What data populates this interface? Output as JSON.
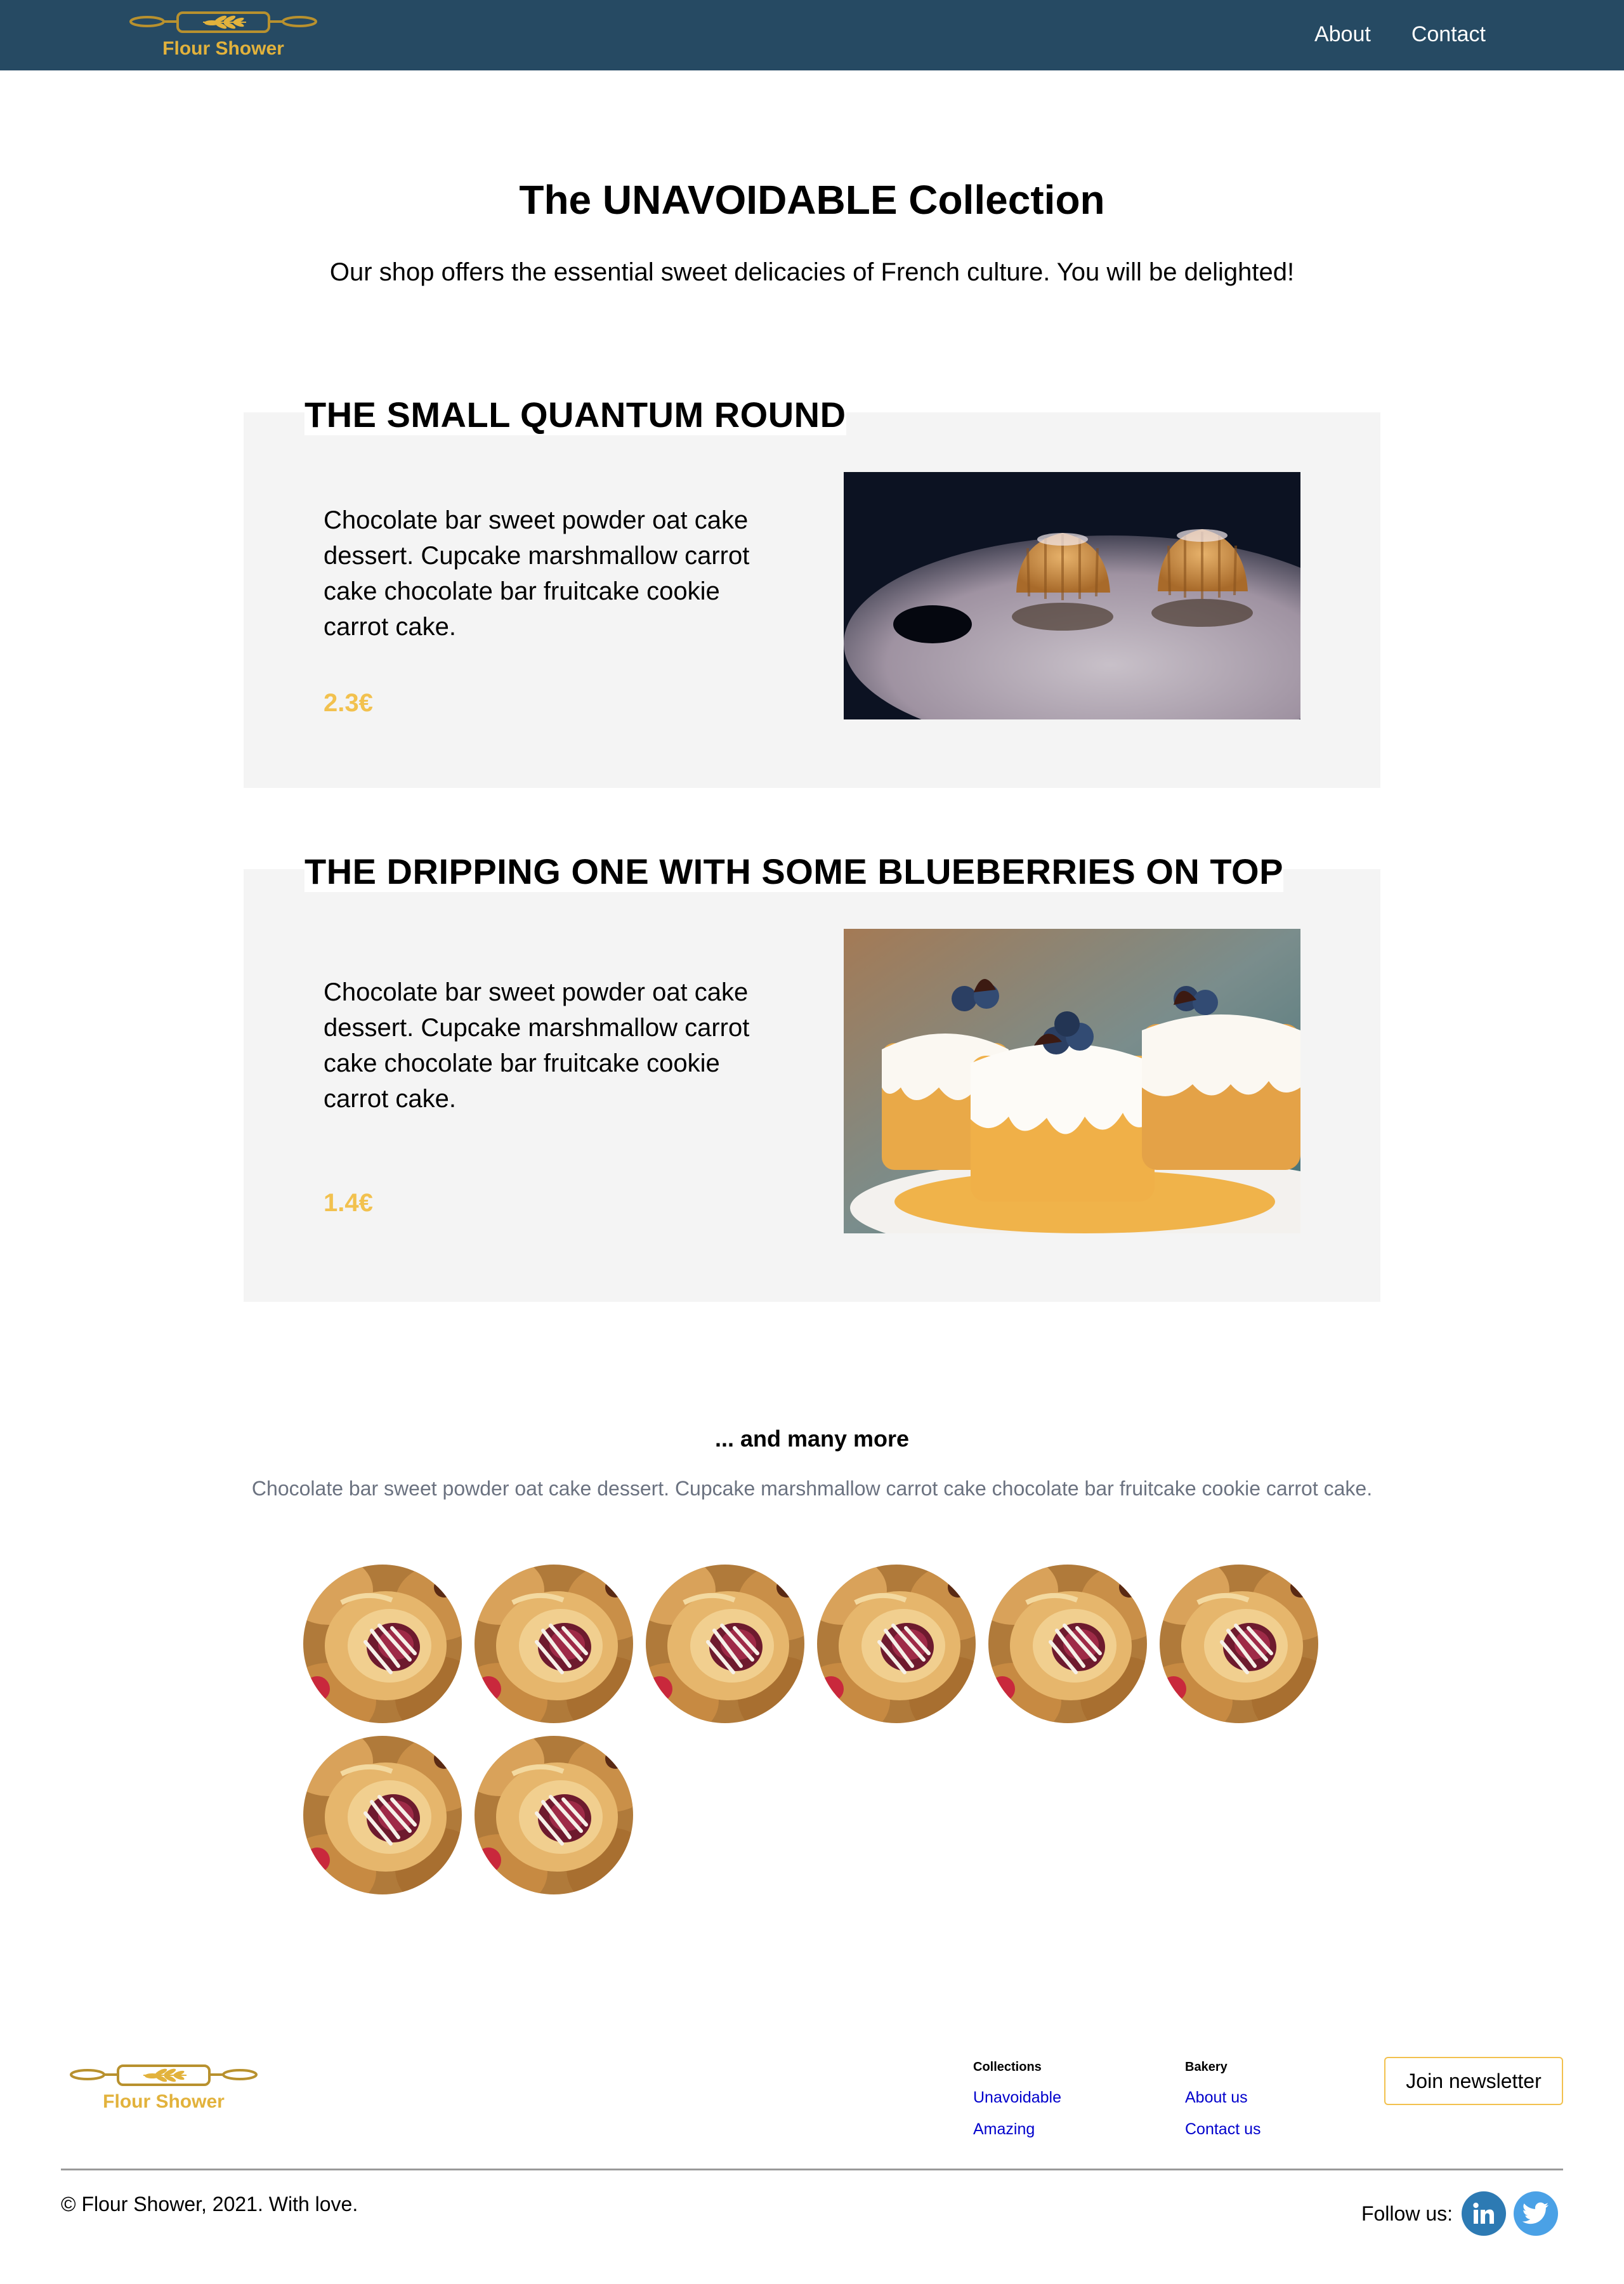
{
  "brand": {
    "name": "Flour Shower",
    "accent_color": "#f2c14e",
    "header_color": "#264a63"
  },
  "nav": {
    "items": [
      "About",
      "Contact"
    ]
  },
  "hero": {
    "title": "The UNAVOIDABLE Collection",
    "subtitle": "Our shop offers the essential sweet delicacies of French culture. You will be delighted!"
  },
  "products": [
    {
      "title": "THE SMALL QUANTUM ROUND",
      "description": "Chocolate bar sweet powder oat cake dessert. Cupcake marshmallow carrot cake chocolate bar fruitcake cookie carrot cake.",
      "price": "2.3€",
      "image": "two-mini-bundt-cakes-photo"
    },
    {
      "title": "THE DRIPPING ONE WITH SOME BLUEBERRIES ON TOP",
      "description": "Chocolate bar sweet powder oat cake dessert. Cupcake marshmallow carrot cake chocolate bar fruitcake cookie carrot cake.",
      "price": "1.4€",
      "image": "blueberry-drip-cakes-photo"
    }
  ],
  "more": {
    "title": "... and many more",
    "description": "Chocolate bar sweet powder oat cake dessert. Cupcake marshmallow carrot cake chocolate bar fruitcake cookie carrot cake.",
    "thumbnails": 8
  },
  "footer": {
    "columns": [
      {
        "title": "Collections",
        "links": [
          "Unavoidable",
          "Amazing"
        ]
      },
      {
        "title": "Bakery",
        "links": [
          "About us",
          "Contact us"
        ]
      }
    ],
    "newsletter_label": "Join newsletter",
    "copyright": "© Flour Shower, 2021. With love.",
    "follow_label": "Follow us:",
    "social": [
      {
        "icon": "linkedin-icon",
        "color": "#2d7ab3"
      },
      {
        "icon": "twitter-icon",
        "color": "#4aa1e6"
      }
    ]
  }
}
